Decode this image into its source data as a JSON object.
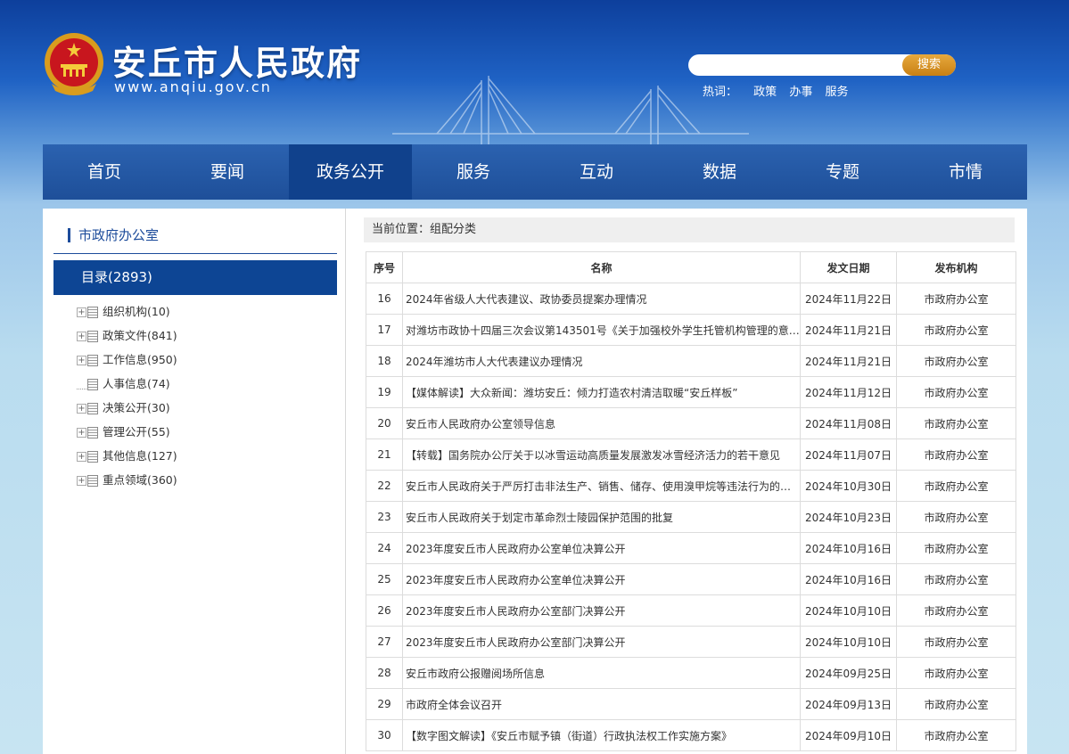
{
  "header": {
    "site_name": "安丘市人民政府",
    "site_url": "www.anqiu.gov.cn",
    "search": {
      "placeholder": "",
      "button_label": "搜索"
    },
    "hot": {
      "label": "热词：",
      "words": [
        "政策",
        "办事",
        "服务"
      ]
    }
  },
  "nav": {
    "items": [
      "首页",
      "要闻",
      "政务公开",
      "服务",
      "互动",
      "数据",
      "专题",
      "市情"
    ],
    "active": "政务公开"
  },
  "sidebar": {
    "title": "市政府办公室",
    "directory_label": "目录(2893)",
    "tree": [
      {
        "label": "组织机构(10)",
        "expandable": true
      },
      {
        "label": "政策文件(841)",
        "expandable": true
      },
      {
        "label": "工作信息(950)",
        "expandable": true
      },
      {
        "label": "人事信息(74)",
        "expandable": false
      },
      {
        "label": "决策公开(30)",
        "expandable": true
      },
      {
        "label": "管理公开(55)",
        "expandable": true
      },
      {
        "label": "其他信息(127)",
        "expandable": true
      },
      {
        "label": "重点领域(360)",
        "expandable": true
      }
    ]
  },
  "breadcrumb": "当前位置：组配分类",
  "table": {
    "headers": [
      "序号",
      "名称",
      "发文日期",
      "发布机构"
    ],
    "rows": [
      [
        "16",
        "2024年省级人大代表建议、政协委员提案办理情况",
        "2024年11月22日",
        "市政府办公室"
      ],
      [
        "17",
        "对潍坊市政协十四届三次会议第143501号《关于加强校外学生托管机构管理的意…",
        "2024年11月21日",
        "市政府办公室"
      ],
      [
        "18",
        "2024年潍坊市人大代表建议办理情况",
        "2024年11月21日",
        "市政府办公室"
      ],
      [
        "19",
        "【媒体解读】大众新闻：潍坊安丘：倾力打造农村清洁取暖“安丘样板”",
        "2024年11月12日",
        "市政府办公室"
      ],
      [
        "20",
        "安丘市人民政府办公室领导信息",
        "2024年11月08日",
        "市政府办公室"
      ],
      [
        "21",
        "【转载】国务院办公厅关于以冰雪运动高质量发展激发冰雪经济活力的若干意见",
        "2024年11月07日",
        "市政府办公室"
      ],
      [
        "22",
        "安丘市人民政府关于严厉打击非法生产、销售、储存、使用溴甲烷等违法行为的…",
        "2024年10月30日",
        "市政府办公室"
      ],
      [
        "23",
        "安丘市人民政府关于划定市革命烈士陵园保护范围的批复",
        "2024年10月23日",
        "市政府办公室"
      ],
      [
        "24",
        "2023年度安丘市人民政府办公室单位决算公开",
        "2024年10月16日",
        "市政府办公室"
      ],
      [
        "25",
        "2023年度安丘市人民政府办公室单位决算公开",
        "2024年10月16日",
        "市政府办公室"
      ],
      [
        "26",
        "2023年度安丘市人民政府办公室部门决算公开",
        "2024年10月10日",
        "市政府办公室"
      ],
      [
        "27",
        "2023年度安丘市人民政府办公室部门决算公开",
        "2024年10月10日",
        "市政府办公室"
      ],
      [
        "28",
        "安丘市政府公报赠阅场所信息",
        "2024年09月25日",
        "市政府办公室"
      ],
      [
        "29",
        "市政府全体会议召开",
        "2024年09月13日",
        "市政府办公室"
      ],
      [
        "30",
        "【数字图文解读】《安丘市赋予镇（街道）行政执法权工作实施方案》",
        "2024年09月10日",
        "市政府办公室"
      ]
    ]
  },
  "colors": {
    "nav_bg": "#1e4f99",
    "nav_active": "#10418c",
    "sidebar_accent": "#0d4594",
    "search_button": "#d08a1c"
  }
}
